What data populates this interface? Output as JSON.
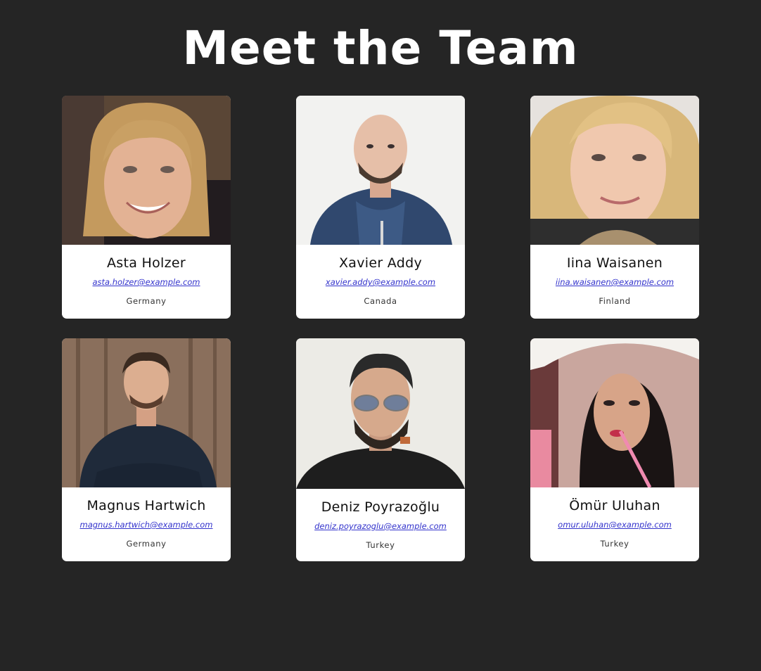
{
  "page": {
    "title": "Meet the Team"
  },
  "team": [
    {
      "name": "Asta Holzer",
      "email": "asta.holzer@example.com",
      "country": "Germany"
    },
    {
      "name": "Xavier Addy",
      "email": "xavier.addy@example.com",
      "country": "Canada"
    },
    {
      "name": "Iina Waisanen",
      "email": "iina.waisanen@example.com",
      "country": "Finland"
    },
    {
      "name": "Magnus Hartwich",
      "email": "magnus.hartwich@example.com",
      "country": "Germany"
    },
    {
      "name": "Deniz Poyrazoğlu",
      "email": "deniz.poyrazoglu@example.com",
      "country": "Turkey"
    },
    {
      "name": "Ömür Uluhan",
      "email": "omur.uluhan@example.com",
      "country": "Turkey"
    }
  ],
  "colors": {
    "background": "#252525",
    "card": "#ffffff",
    "link": "#3333cc"
  }
}
